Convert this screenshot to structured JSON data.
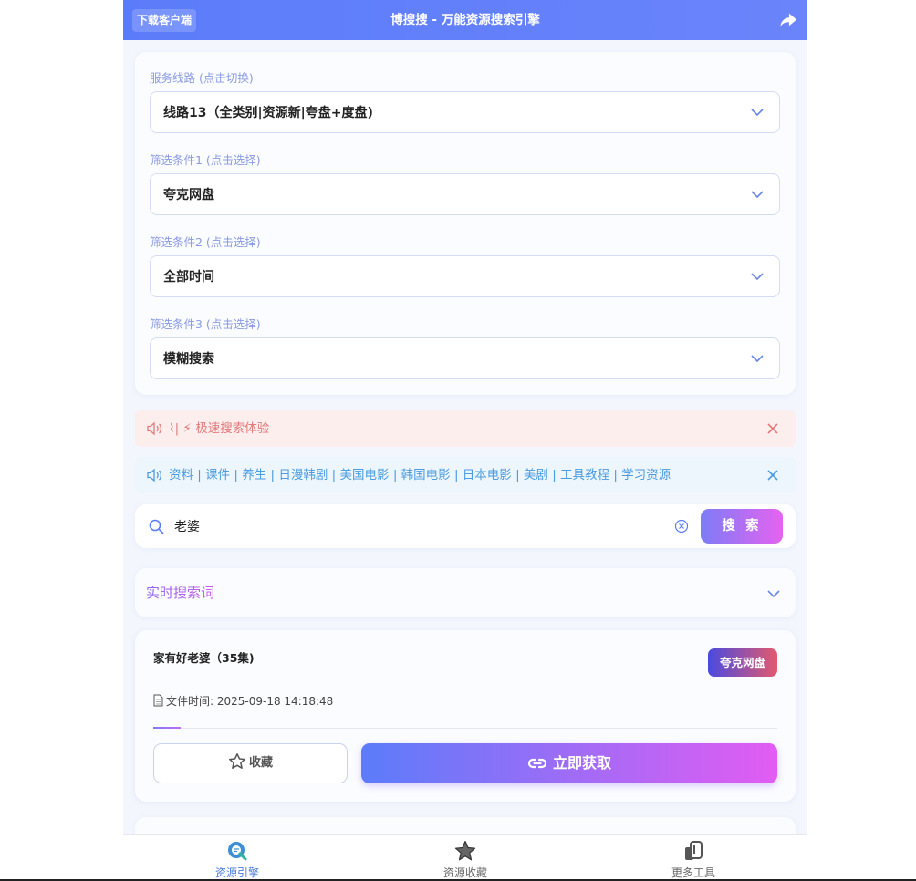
{
  "header": {
    "download_label": "下载客户端",
    "title": "博搜搜 - 万能资源搜索引擎"
  },
  "filters": [
    {
      "label": "服务线路 (点击切换)",
      "value": "线路13（全类别|资源新|夸盘+度盘)"
    },
    {
      "label": "筛选条件1 (点击选择)",
      "value": "夸克网盘"
    },
    {
      "label": "筛选条件2 (点击选择)",
      "value": "全部时间"
    },
    {
      "label": "筛选条件3 (点击选择)",
      "value": "模糊搜索"
    }
  ],
  "notices": {
    "alert_text": "⌇| ⚡ 极速搜索体验",
    "categories_text": "资料 | 课件 | 养生 | 日漫韩剧 | 美国电影 | 韩国电影 | 日本电影 | 美剧 | 工具教程 | 学习资源"
  },
  "search": {
    "query": "老婆",
    "button_label": "搜 索"
  },
  "hot_words": {
    "title": "实时搜索词"
  },
  "result": {
    "title": "家有好老婆（35集)",
    "badge": "夸克网盘",
    "file_time": "文件时间: 2025-09-18 14:18:48",
    "fav_label": "收藏",
    "get_label": "立即获取"
  },
  "tabs": [
    {
      "label": "资源引擎",
      "icon": "search-engine-icon",
      "active": true
    },
    {
      "label": "资源收藏",
      "icon": "star-icon",
      "active": false
    },
    {
      "label": "更多工具",
      "icon": "tools-icon",
      "active": false
    }
  ],
  "colors": {
    "header": "#5b7cfa",
    "accent_gradient_start": "#5b7cfa",
    "accent_gradient_end": "#e25cf2",
    "badge_start": "#4a4ae0",
    "badge_end": "#e25a6e"
  }
}
